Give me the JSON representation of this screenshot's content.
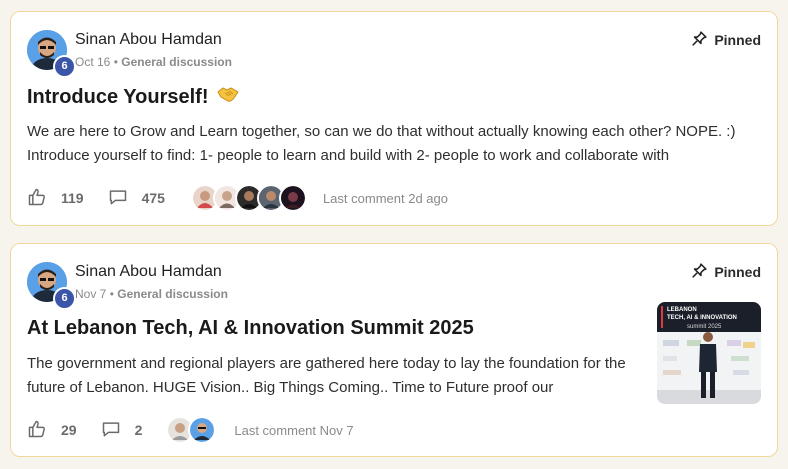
{
  "posts": [
    {
      "author": "Sinan Abou Hamdan",
      "level": "6",
      "date": "Oct 16",
      "separator": "•",
      "category": "General discussion",
      "pinned_label": "Pinned",
      "title": "Introduce Yourself!",
      "title_emoji": "handshake",
      "body": "We are here to Grow and Learn together, so can we do that without actually knowing each other? NOPE. :) Introduce yourself to find: 1- people to learn and build with 2- people to work and collaborate with",
      "likes": "119",
      "comments": "475",
      "last_comment": "Last comment 2d ago"
    },
    {
      "author": "Sinan Abou Hamdan",
      "level": "6",
      "date": "Nov 7",
      "separator": "•",
      "category": "General discussion",
      "pinned_label": "Pinned",
      "title": "At Lebanon Tech, AI & Innovation Summit 2025",
      "body": "The government and regional players are gathered here today to lay the foundation for the future of Lebanon. HUGE Vision.. Big Things Coming.. Time to Future proof our",
      "likes": "29",
      "comments": "2",
      "last_comment": "Last comment Nov 7",
      "thumbnail_text_line1": "LEBANON",
      "thumbnail_text_line2": "TECH, AI & INNOVATION",
      "thumbnail_text_line3": "summit 2025"
    }
  ],
  "colors": {
    "card_border": "#f0d89a",
    "badge": "#3b56a8",
    "background": "#f7f4ee"
  }
}
